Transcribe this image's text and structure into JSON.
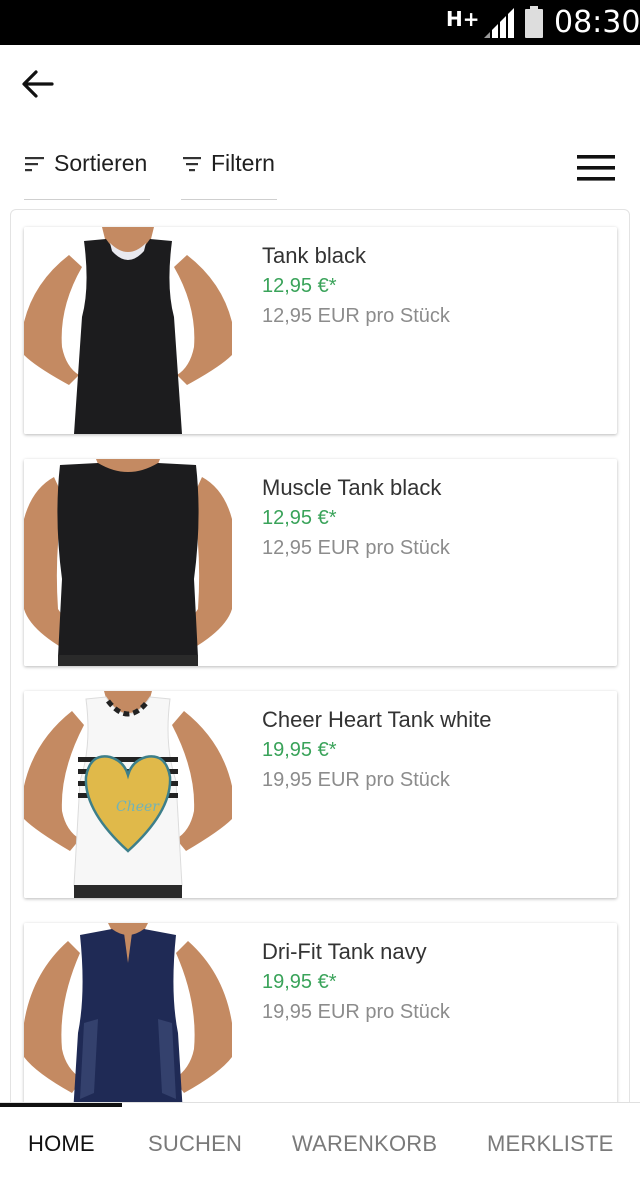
{
  "status_bar": {
    "network": "H+",
    "time": "08:30"
  },
  "toolbar": {
    "sort_label": "Sortieren",
    "filter_label": "Filtern"
  },
  "products": [
    {
      "name": "Tank black",
      "price": "12,95 €*",
      "unit_price": "12,95 EUR pro Stück"
    },
    {
      "name": "Muscle Tank black",
      "price": "12,95 €*",
      "unit_price": "12,95 EUR pro Stück"
    },
    {
      "name": "Cheer Heart Tank white",
      "price": "19,95 €*",
      "unit_price": "19,95 EUR pro Stück"
    },
    {
      "name": "Dri-Fit Tank navy",
      "price": "19,95 €*",
      "unit_price": "19,95 EUR pro Stück"
    }
  ],
  "bottom_nav": {
    "items": [
      "HOME",
      "SUCHEN",
      "WARENKORB",
      "MERKLISTE"
    ],
    "active": "HOME"
  },
  "colors": {
    "price_green": "#3aa35a",
    "unit_gray": "#8c8c8c",
    "skin": "#c48a62",
    "black_top": "#1c1c1e",
    "navy_top": "#1f2a55",
    "heart_gold": "#e0b94a"
  }
}
